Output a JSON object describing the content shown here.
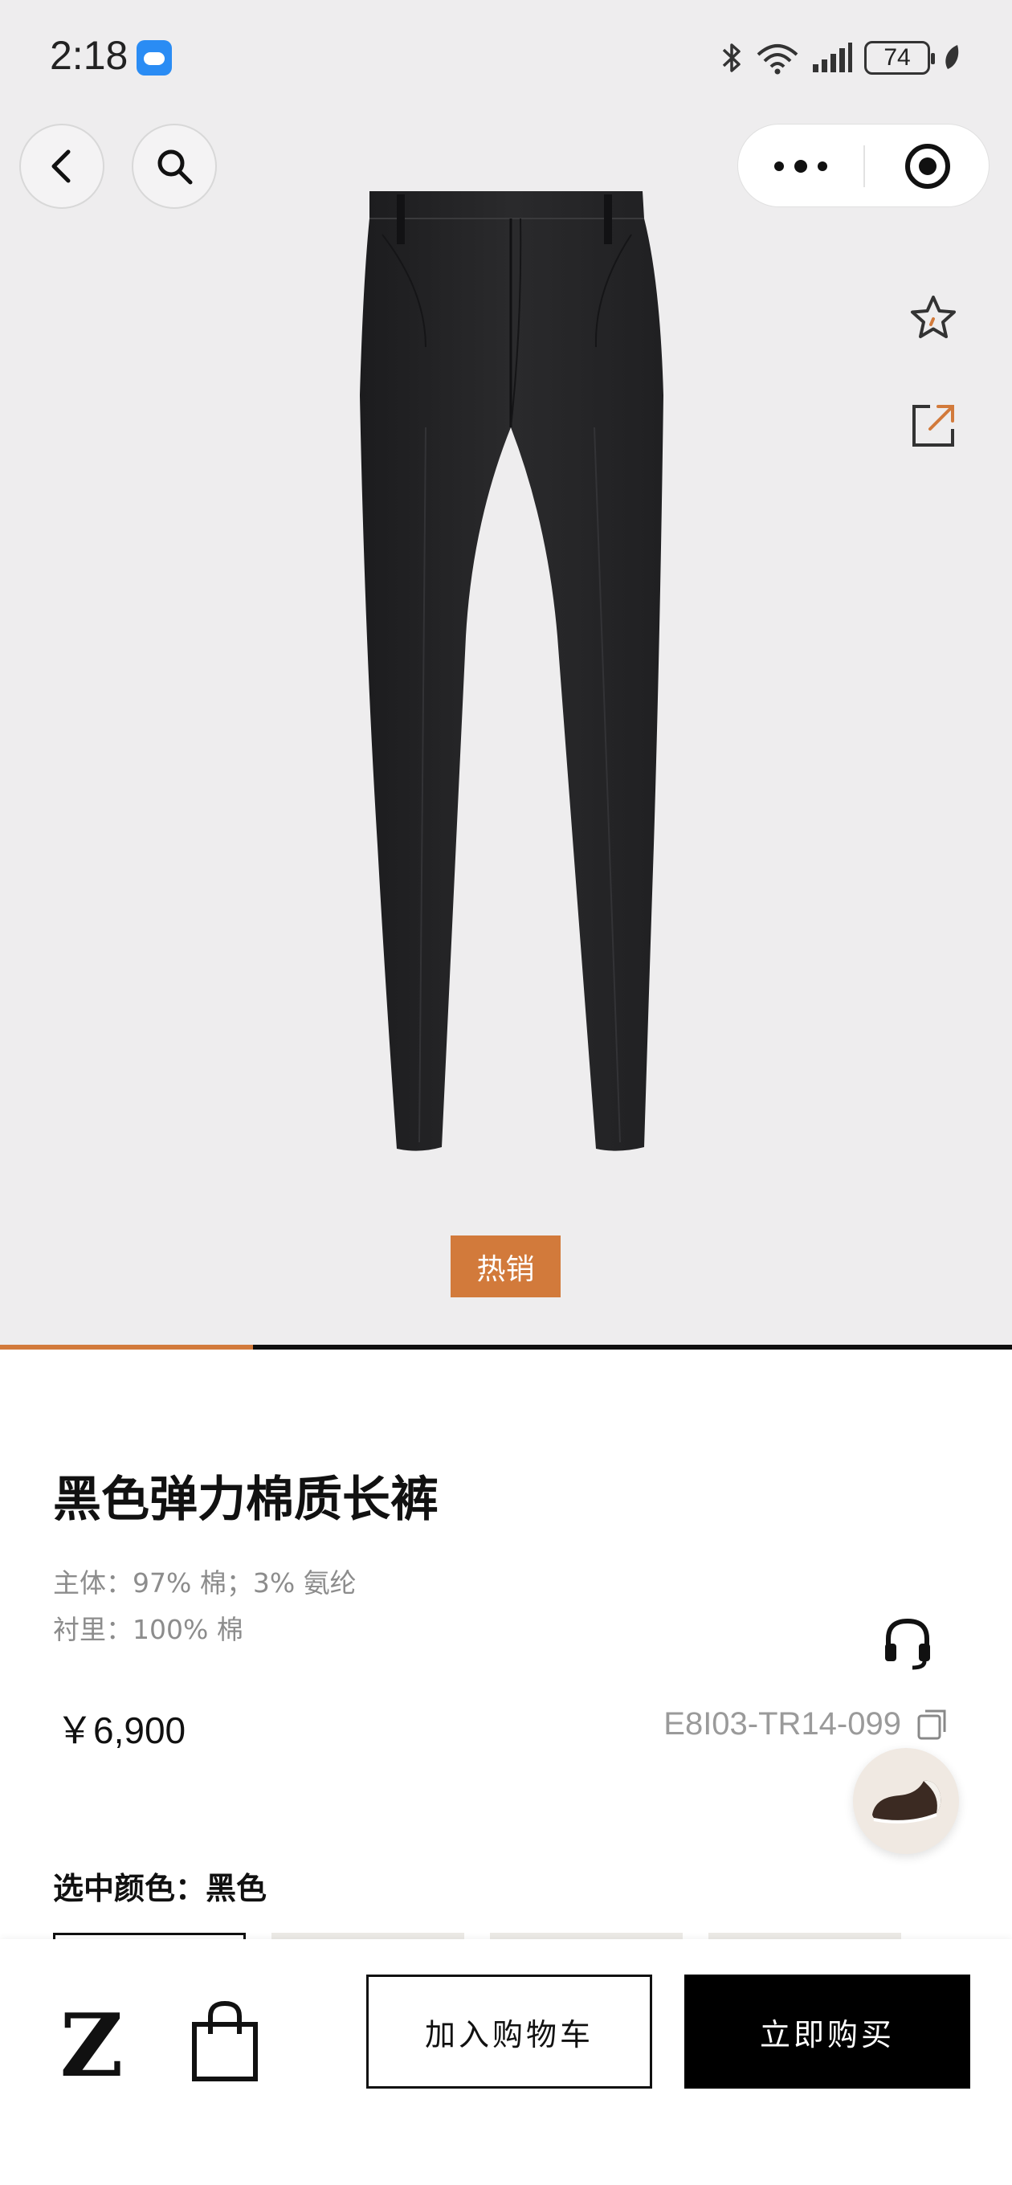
{
  "status_bar": {
    "time": "2:18",
    "battery": "74",
    "icons": [
      "weather-app-icon",
      "bluetooth-icon",
      "wifi-icon",
      "signal-icon",
      "battery-icon",
      "leaf-icon"
    ]
  },
  "nav": {
    "back_icon": "chevron-left-icon",
    "search_icon": "search-icon",
    "more_icon": "more-dots-icon",
    "close_icon": "target-close-icon"
  },
  "actions": {
    "favorite_icon": "star-icon",
    "share_icon": "share-icon"
  },
  "hero": {
    "badge": "热销",
    "progress": 0.25,
    "colors": {
      "accent": "#d27a3b",
      "background": "#eeedee"
    }
  },
  "product": {
    "title": "黑色弹力棉质长裤",
    "material_main": "主体：97% 棉；3% 氨纶",
    "material_lining": "衬里：100% 棉",
    "price": "￥6,900",
    "sku": "E8I03-TR14-099",
    "color_label": "选中颜色：黑色"
  },
  "bottom_bar": {
    "logo": "Z",
    "bag_icon": "shopping-bag-icon",
    "add_to_cart": "加入购物车",
    "buy_now": "立即购买"
  }
}
